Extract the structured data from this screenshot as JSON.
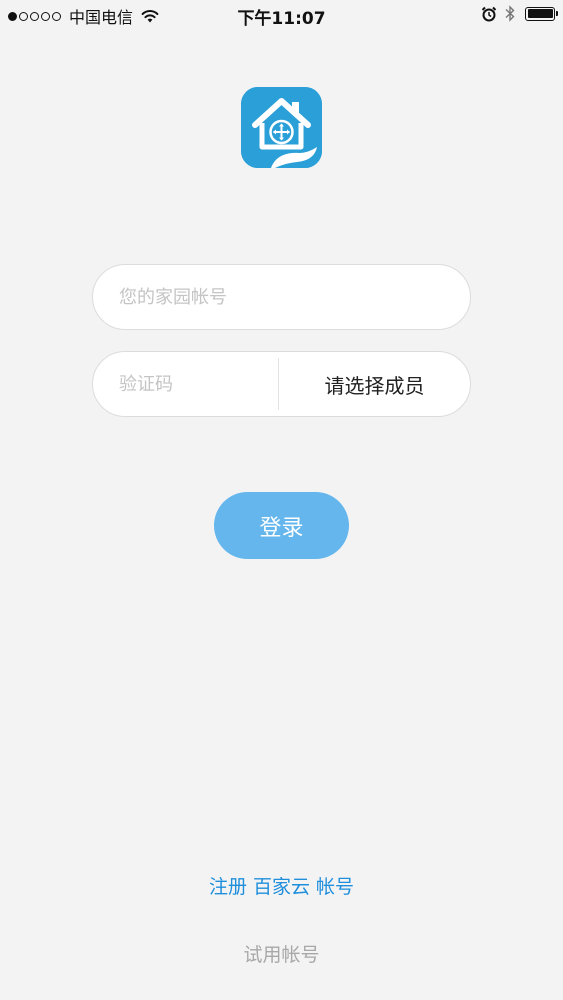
{
  "status_bar": {
    "carrier": "中国电信",
    "time": "下午11:07",
    "signal_strength": 1,
    "signal_max": 5,
    "battery_level": 1.0
  },
  "app": {
    "icon": "house-move-arrows-icon",
    "icon_color": "#2b9fd8"
  },
  "login_form": {
    "account_placeholder": "您的家园帐号",
    "account_value": "",
    "code_placeholder": "验证码",
    "code_value": "",
    "member_select_label": "请选择成员",
    "login_label": "登录",
    "login_color": "#64b6ec"
  },
  "footer": {
    "register_label": "注册 百家云 帐号",
    "trial_label": "试用帐号",
    "link_color": "#1f8fdc"
  }
}
